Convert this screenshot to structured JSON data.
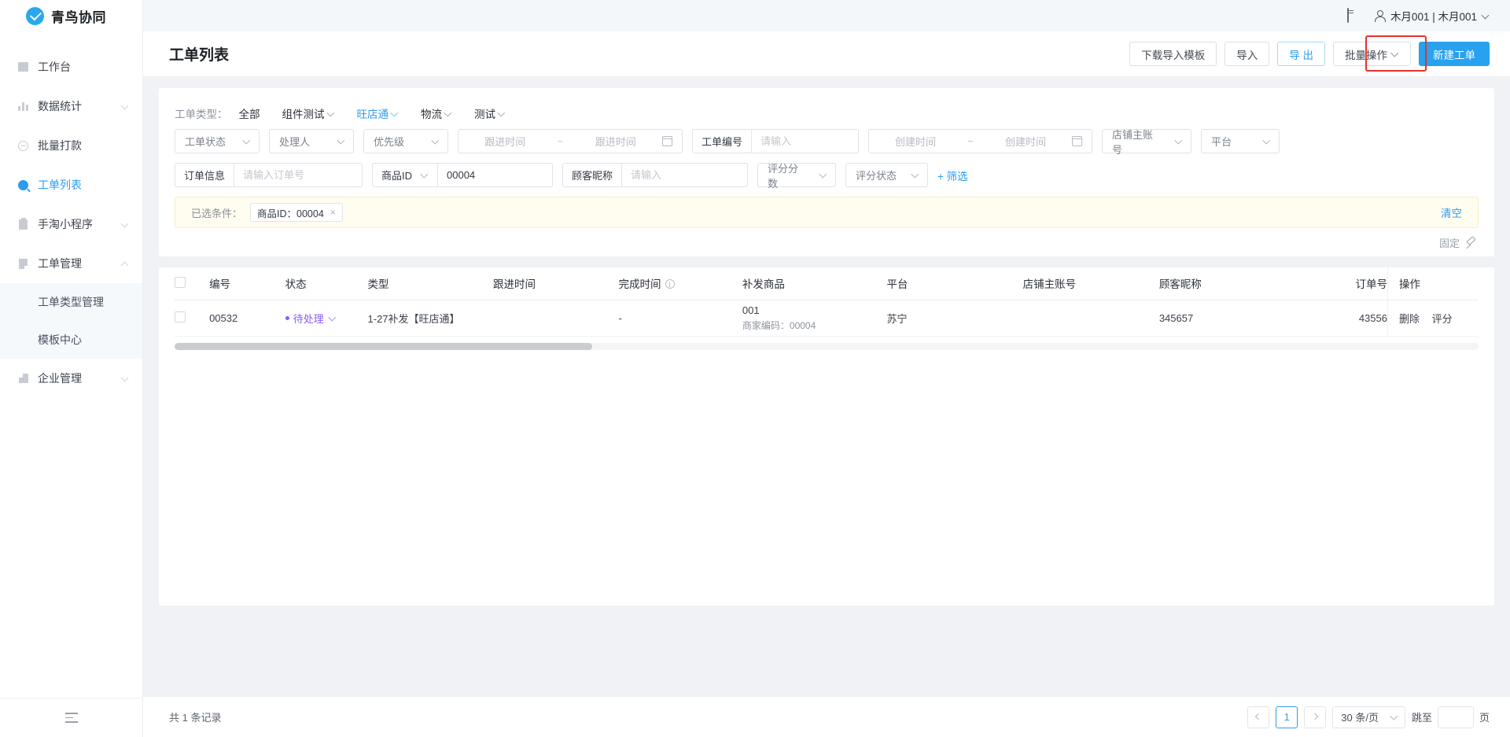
{
  "brand": {
    "name": "青鸟协同",
    "logo_icon": "check-circle-icon",
    "accent": "#2d9cf0"
  },
  "topbar": {
    "card_icon": "id-card-icon",
    "user_icon": "person-icon",
    "user_name": "木月001 | 木月001",
    "caret_icon": "chevron-down-icon"
  },
  "sidebar": {
    "items": [
      {
        "label": "工作台",
        "icon": "workbench-icon",
        "expandable": false,
        "active": false
      },
      {
        "label": "数据统计",
        "icon": "bar-chart-icon",
        "expandable": true,
        "active": false
      },
      {
        "label": "批量打款",
        "icon": "coin-icon",
        "expandable": false,
        "active": false
      },
      {
        "label": "工单列表",
        "icon": "search-icon",
        "expandable": false,
        "active": true
      },
      {
        "label": "手淘小程序",
        "icon": "clipboard-icon",
        "expandable": true,
        "active": false
      },
      {
        "label": "工单管理",
        "icon": "document-icon",
        "expandable": true,
        "active": true,
        "expanded": true
      },
      {
        "label": "企业管理",
        "icon": "building-icon",
        "expandable": true,
        "active": false
      }
    ],
    "submenu": [
      {
        "label": "工单类型管理"
      },
      {
        "label": "模板中心"
      }
    ],
    "collapse_icon": "collapse-panel-icon"
  },
  "page": {
    "title": "工单列表"
  },
  "toolbar": {
    "download_template": "下载导入模板",
    "import": "导入",
    "export": "导 出",
    "batch_ops": "批量操作",
    "new_ticket": "新建工单",
    "highlight_color": "#e8312c"
  },
  "filters": {
    "type_label": "工单类型：",
    "types": [
      {
        "label": "全部",
        "caret": false,
        "active": false
      },
      {
        "label": "组件测试",
        "caret": true,
        "active": false
      },
      {
        "label": "旺店通",
        "caret": true,
        "active": true
      },
      {
        "label": "物流",
        "caret": true,
        "active": false
      },
      {
        "label": "测试",
        "caret": true,
        "active": false
      }
    ],
    "row1": {
      "ticket_status": "工单状态",
      "handler": "处理人",
      "priority": "优先级",
      "follow_time_start": "跟进时间",
      "follow_time_tilde": "~",
      "follow_time_end": "跟进时间",
      "ticket_no_label": "工单编号",
      "ticket_no_placeholder": "请输入",
      "ticket_no_value": "",
      "create_time_start": "创建时间",
      "create_time_tilde": "~",
      "create_time_end": "创建时间",
      "shop_account": "店铺主账号",
      "platform": "平台"
    },
    "row2": {
      "order_label": "订单信息",
      "order_placeholder": "请输入订单号",
      "order_value": "",
      "goods_label": "商品ID",
      "goods_value": "00004",
      "nickname_label": "顾客昵称",
      "nickname_placeholder": "请输入",
      "nickname_value": "",
      "score_value": "评分分数",
      "score_status": "评分状态",
      "more_filter": "+ 筛选"
    },
    "selected": {
      "label": "已选条件：",
      "tags": [
        {
          "text": "商品ID：00004",
          "close": "×"
        }
      ],
      "clear": "清空"
    },
    "fix": {
      "label": "固定",
      "icon": "pin-icon"
    }
  },
  "table": {
    "columns": [
      "编号",
      "状态",
      "类型",
      "跟进时间",
      "完成时间",
      "补发商品",
      "平台",
      "店铺主账号",
      "顾客昵称",
      "订单号",
      "操作"
    ],
    "completed_time_has_info_icon": true,
    "rows": [
      {
        "id": "00532",
        "status": "待处理",
        "status_color": "#8a5cf5",
        "type": "1-27补发【旺店通】",
        "follow_time": "",
        "complete_time": "-",
        "goods_name": "001",
        "goods_code": "商家编码：00004",
        "platform": "苏宁",
        "shop_account": "",
        "nickname": "345657",
        "order_no": "43556",
        "actions": [
          "删除",
          "评分"
        ]
      }
    ]
  },
  "footer": {
    "record_text": "共 1 条记录",
    "current_page": "1",
    "page_size": "30 条/页",
    "jump_label": "跳至",
    "jump_value": "",
    "jump_suffix": "页",
    "prev_icon": "chevron-left-icon",
    "next_icon": "chevron-right-icon"
  }
}
